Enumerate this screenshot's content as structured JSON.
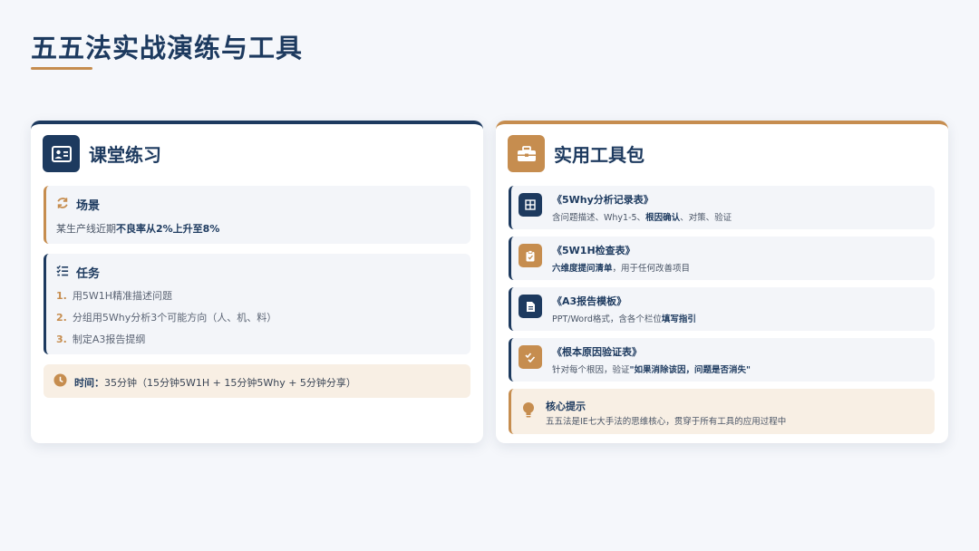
{
  "page": {
    "title": "五五法实战演练与工具"
  },
  "exercise": {
    "title": "课堂练习",
    "scene": {
      "heading": "场景",
      "text_prefix": "某生产线近期",
      "text_bold": "不良率从2%上升至8%"
    },
    "task": {
      "heading": "任务",
      "items": [
        {
          "num": "1.",
          "text": "用5W1H精准描述问题"
        },
        {
          "num": "2.",
          "text": "分组用5Why分析3个可能方向（人、机、料）"
        },
        {
          "num": "3.",
          "text": "制定A3报告提纲"
        }
      ]
    },
    "time": {
      "label": "时间：",
      "value": "35分钟（15分钟5W1H + 15分钟5Why + 5分钟分享）"
    }
  },
  "toolkit": {
    "title": "实用工具包",
    "tools": [
      {
        "name": "《5Why分析记录表》",
        "desc_prefix": "含问题描述、Why1-5、",
        "desc_bold": "根因确认",
        "desc_suffix": "、对策、验证"
      },
      {
        "name": "《5W1H检查表》",
        "desc_prefix": "",
        "desc_bold": "六维度提问清单",
        "desc_suffix": "，用于任何改善项目"
      },
      {
        "name": "《A3报告模板》",
        "desc_prefix": "PPT/Word格式，含各个栏位",
        "desc_bold": "填写指引",
        "desc_suffix": ""
      },
      {
        "name": "《根本原因验证表》",
        "desc_prefix": "针对每个根因，验证",
        "desc_bold": "\"如果消除该因，问题是否消失\"",
        "desc_suffix": ""
      }
    ],
    "tip": {
      "title": "核心提示",
      "desc": "五五法是IE七大手法的思维核心，贯穿于所有工具的应用过程中"
    }
  },
  "colors": {
    "navy": "#1d3a5f",
    "gold": "#c68d4f",
    "block_bg": "#f3f5f9",
    "warm_bg": "#f8efe4"
  }
}
